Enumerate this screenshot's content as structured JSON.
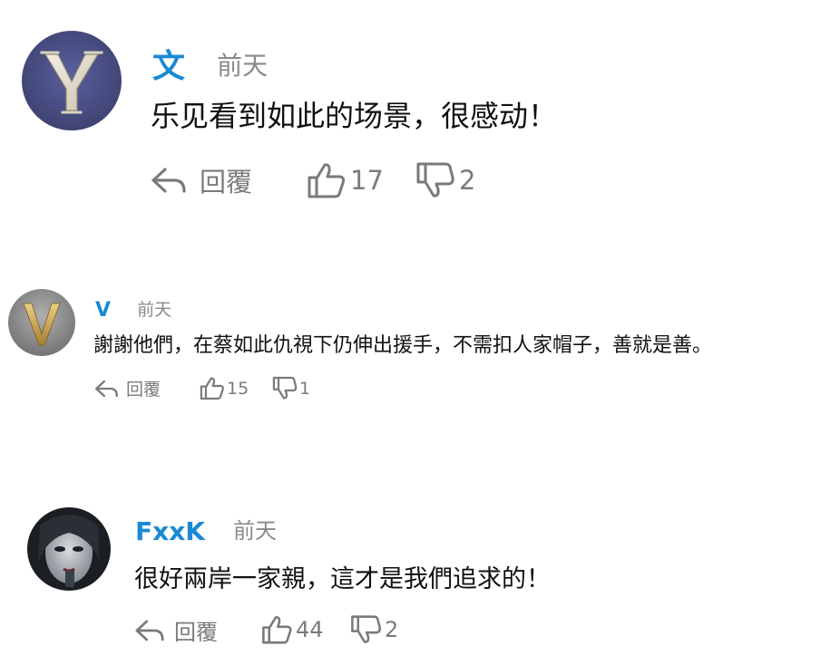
{
  "comments": [
    {
      "username": "文",
      "time": "前天",
      "text": "乐见看到如此的场景，很感动！",
      "reply_label": "回覆",
      "likes": "17",
      "dislikes": "2",
      "avatar_letter": "Y"
    },
    {
      "username": "V",
      "time": "前天",
      "text": "謝謝他們，在蔡如此仇視下仍伸出援手，不需扣人家帽子，善就是善。",
      "reply_label": "回覆",
      "likes": "15",
      "dislikes": "1",
      "avatar_letter": "V"
    },
    {
      "username": "FxxK",
      "time": "前天",
      "text": "很好兩岸一家親，這才是我們追求的！",
      "reply_label": "回覆",
      "likes": "44",
      "dislikes": "2"
    }
  ],
  "colors": {
    "username": "#1a8ad4",
    "meta_gray": "#8a8a8a",
    "text": "#111111",
    "avatar1_bg": "#4a4e8c",
    "avatar2_bg": "#8a8a8a"
  }
}
